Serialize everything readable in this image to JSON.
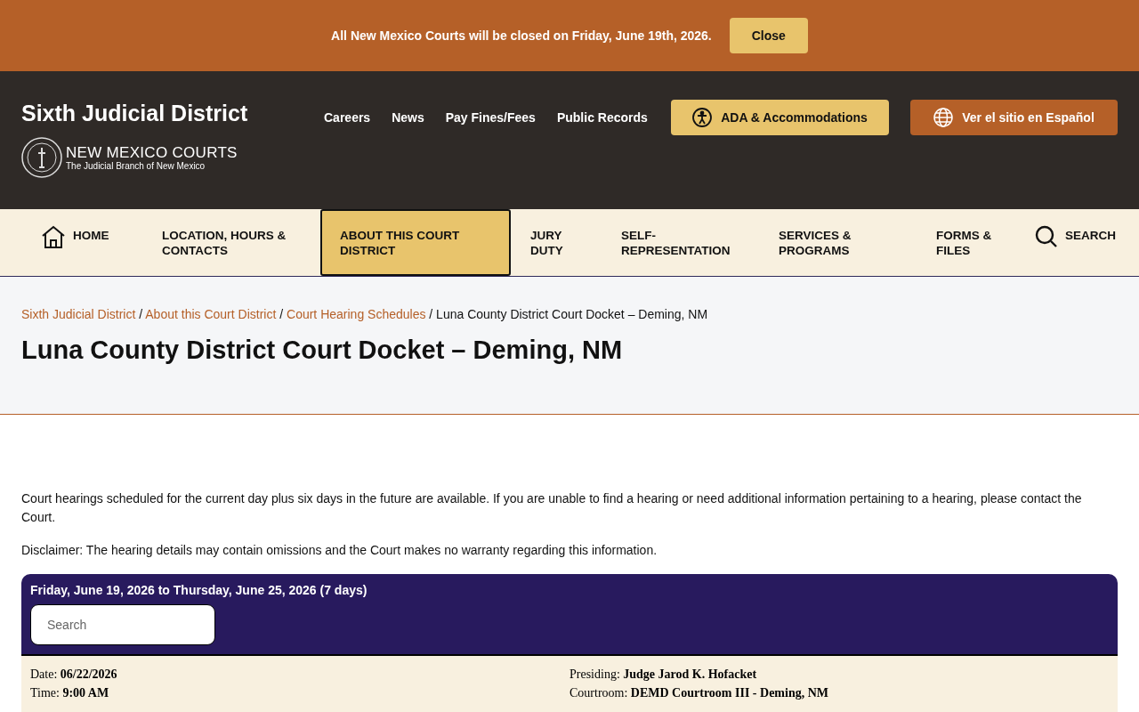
{
  "alert_banner": {
    "message": "All New Mexico Courts will be closed on Friday, June 19th, 2026.",
    "button": "Close"
  },
  "header": {
    "site_title": "Sixth Judicial District",
    "logo": {
      "name": "NEW MEXICO COURTS",
      "tagline": "The Judicial Branch of New Mexico"
    },
    "links": [
      "Careers",
      "News",
      "Pay Fines/Fees",
      "Public Records"
    ],
    "buttons": [
      {
        "kind": "ada",
        "label": "ADA & Accommodations"
      },
      {
        "kind": "language",
        "label": "Ver el sitio en Español"
      }
    ]
  },
  "main_nav": {
    "items": [
      {
        "kind": "home",
        "label": "HOME",
        "selected": false
      },
      {
        "kind": "link",
        "label": "LOCATION, HOURS & CONTACTS",
        "selected": false
      },
      {
        "kind": "link",
        "label": "ABOUT THIS COURT DISTRICT",
        "selected": true
      },
      {
        "kind": "link",
        "label": "JURY DUTY",
        "selected": false
      },
      {
        "kind": "link",
        "label": "SELF-REPRESENTATION",
        "selected": false
      },
      {
        "kind": "link",
        "label": "SERVICES & PROGRAMS",
        "selected": false
      },
      {
        "kind": "link",
        "label": "FORMS & FILES",
        "selected": false
      },
      {
        "kind": "search",
        "label": "SEARCH",
        "selected": false
      }
    ]
  },
  "breadcrumb": {
    "separator": "/",
    "links": [
      "Sixth Judicial District",
      "About this Court District",
      "Court Hearing Schedules"
    ],
    "current": "Luna County District Court Docket – Deming, NM"
  },
  "page_title": "Luna County District Court Docket – Deming, NM",
  "intro": [
    "Court hearings scheduled for the current day plus six days in the future are available. If you are unable to find a hearing or need additional information pertaining to a hearing, please contact the Court.",
    "Disclaimer:  The hearing details may contain omissions and the Court makes no warranty regarding this information."
  ],
  "docket": {
    "range": "Friday, June 19, 2026 to Thursday, June 25, 2026 (7 days)",
    "search": {
      "placeholder": "Search"
    },
    "hearing": {
      "left": [
        {
          "label": "Date:",
          "value": "06/22/2026"
        },
        {
          "label": "Time:",
          "value": "9:00 AM"
        }
      ],
      "right": [
        {
          "label": "Presiding:",
          "value": "Judge Jarod K. Hofacket"
        },
        {
          "label": "Courtroom:",
          "value": "DEMD Courtroom III - Deming, NM"
        }
      ]
    }
  }
}
